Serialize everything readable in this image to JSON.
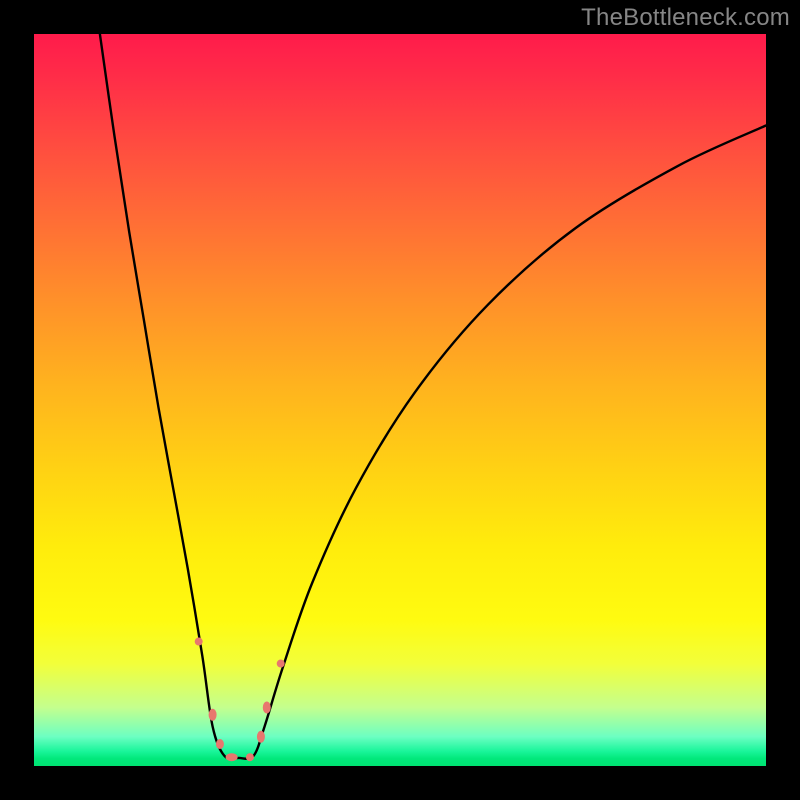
{
  "watermark_text": "TheBottleneck.com",
  "chart_data": {
    "type": "line",
    "title": "",
    "xlabel": "",
    "ylabel": "",
    "xlim": [
      0,
      100
    ],
    "ylim": [
      0,
      100
    ],
    "grid": false,
    "legend": false,
    "gradient_stops": [
      {
        "pos": 0.0,
        "color": "#ff1b4b"
      },
      {
        "pos": 0.5,
        "color": "#ffb31e"
      },
      {
        "pos": 0.8,
        "color": "#fffb10"
      },
      {
        "pos": 1.0,
        "color": "#00e472"
      }
    ],
    "series": [
      {
        "name": "left-branch",
        "x": [
          9.0,
          11.0,
          13.0,
          15.0,
          17.0,
          19.0,
          21.0,
          23.0,
          24.4
        ],
        "values": [
          100.0,
          86.0,
          73.0,
          61.0,
          49.0,
          38.0,
          27.0,
          15.0,
          5.4
        ]
      },
      {
        "name": "valley-floor",
        "x": [
          24.4,
          26.0,
          28.0,
          30.0,
          31.5
        ],
        "values": [
          5.4,
          1.4,
          1.1,
          1.4,
          5.4
        ]
      },
      {
        "name": "right-branch",
        "x": [
          31.5,
          34.0,
          38.0,
          44.0,
          52.0,
          62.0,
          74.0,
          88.0,
          100.0
        ],
        "values": [
          5.4,
          13.5,
          25.0,
          38.0,
          51.0,
          63.0,
          73.5,
          82.0,
          87.5
        ]
      }
    ],
    "markers": [
      {
        "name": "left-upper",
        "x": 22.5,
        "y": 17.0,
        "rx": 4,
        "ry": 4
      },
      {
        "name": "left-mid",
        "x": 24.4,
        "y": 7.0,
        "rx": 4,
        "ry": 6
      },
      {
        "name": "left-lower",
        "x": 25.4,
        "y": 3.0,
        "rx": 4,
        "ry": 5
      },
      {
        "name": "floor-left",
        "x": 27.0,
        "y": 1.2,
        "rx": 6,
        "ry": 4
      },
      {
        "name": "floor-right",
        "x": 29.5,
        "y": 1.2,
        "rx": 4,
        "ry": 4
      },
      {
        "name": "right-lower",
        "x": 31.0,
        "y": 4.0,
        "rx": 4,
        "ry": 6
      },
      {
        "name": "right-mid",
        "x": 31.8,
        "y": 8.0,
        "rx": 4,
        "ry": 6
      },
      {
        "name": "right-upper",
        "x": 33.7,
        "y": 14.0,
        "rx": 4,
        "ry": 4
      }
    ]
  }
}
